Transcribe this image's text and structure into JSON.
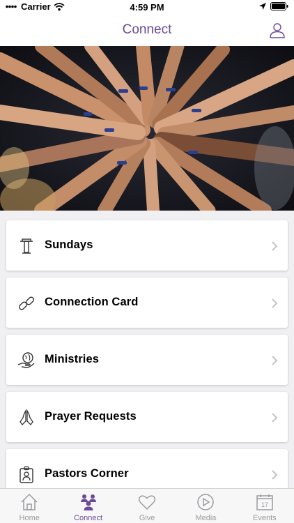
{
  "status_bar": {
    "carrier": "Carrier",
    "time": "4:59 PM"
  },
  "nav": {
    "title": "Connect"
  },
  "hero": {
    "alt": "Hands joined together in a circle"
  },
  "menu": [
    {
      "label": "Sundays",
      "icon": "podium-icon"
    },
    {
      "label": "Connection Card",
      "icon": "link-icon"
    },
    {
      "label": "Ministries",
      "icon": "globe-hand-icon"
    },
    {
      "label": "Prayer Requests",
      "icon": "praying-hands-icon"
    },
    {
      "label": "Pastors Corner",
      "icon": "pastor-badge-icon"
    }
  ],
  "tabs": [
    {
      "label": "Home",
      "icon": "home-icon",
      "active": false
    },
    {
      "label": "Connect",
      "icon": "people-icon",
      "active": true
    },
    {
      "label": "Give",
      "icon": "heart-icon",
      "active": false
    },
    {
      "label": "Media",
      "icon": "play-icon",
      "active": false
    },
    {
      "label": "Events",
      "icon": "calendar-icon",
      "active": false,
      "badge": "17"
    }
  ],
  "colors": {
    "accent": "#6b4a97",
    "inactive": "#9b9b9f",
    "background": "#f0f0f3"
  }
}
